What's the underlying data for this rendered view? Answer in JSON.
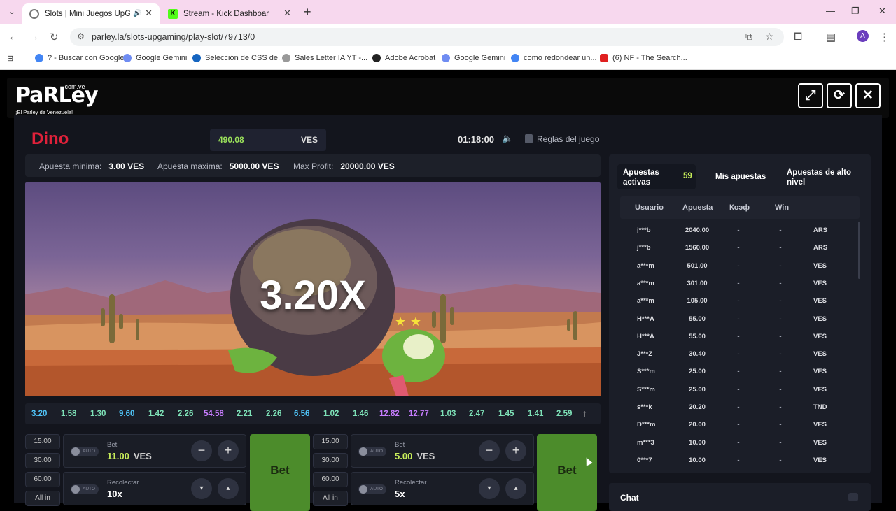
{
  "browser": {
    "tabs": [
      {
        "title": "Slots | Mini Juegos UpGam",
        "audio": "🔊",
        "close": "✕"
      },
      {
        "title": "Stream - Kick Dashboard",
        "close": "✕"
      }
    ],
    "new_tab": "+",
    "url": "parley.la/slots-upgaming/play-slot/79713/0",
    "avatar": "A",
    "bookmarks": [
      "? - Buscar con Google",
      "Google Gemini",
      "Selección de CSS de...",
      "Sales Letter IA YT -...",
      "Adobe Acrobat",
      "Google Gemini",
      "como redondear un...",
      "(6) NF - The Search..."
    ]
  },
  "site": {
    "logo": "PaRLey",
    "logo_sup": ".com.ve",
    "tagline": "¡El Parley de Venezuela!"
  },
  "game": {
    "title": "Dino",
    "balance": "490.08",
    "currency": "VES",
    "clock": "01:18:00",
    "rules": "Reglas del juego",
    "limits": {
      "min_label": "Apuesta minima:",
      "min_value": "3.00 VES",
      "max_label": "Apuesta maxima:",
      "max_value": "5000.00 VES",
      "profit_label": "Max Profit:",
      "profit_value": "20000.00 VES"
    },
    "multiplier": "3.20X",
    "history": [
      {
        "v": "3.20",
        "color": "#4fc3f7"
      },
      {
        "v": "1.58",
        "color": "#7ee2b8"
      },
      {
        "v": "1.30",
        "color": "#7ee2b8"
      },
      {
        "v": "9.60",
        "color": "#4fc3f7"
      },
      {
        "v": "1.42",
        "color": "#7ee2b8"
      },
      {
        "v": "2.26",
        "color": "#7ee2b8"
      },
      {
        "v": "54.58",
        "color": "#c77dff"
      },
      {
        "v": "2.21",
        "color": "#7ee2b8"
      },
      {
        "v": "2.26",
        "color": "#7ee2b8"
      },
      {
        "v": "6.56",
        "color": "#4fc3f7"
      },
      {
        "v": "1.02",
        "color": "#7ee2b8"
      },
      {
        "v": "1.46",
        "color": "#7ee2b8"
      },
      {
        "v": "12.82",
        "color": "#c77dff"
      },
      {
        "v": "12.77",
        "color": "#c77dff"
      },
      {
        "v": "1.03",
        "color": "#7ee2b8"
      },
      {
        "v": "2.47",
        "color": "#7ee2b8"
      },
      {
        "v": "1.45",
        "color": "#7ee2b8"
      },
      {
        "v": "1.41",
        "color": "#7ee2b8"
      },
      {
        "v": "2.59",
        "color": "#7ee2b8"
      }
    ],
    "panels": [
      {
        "quick": [
          "15.00",
          "30.00",
          "60.00",
          "All in"
        ],
        "auto": "AUTO",
        "bet_label": "Bet",
        "bet_value": "11.00",
        "bet_currency": "VES",
        "cashout_label": "Recolectar",
        "cashout_value": "10x",
        "bet_button": "Bet"
      },
      {
        "quick": [
          "15.00",
          "30.00",
          "60.00",
          "All in"
        ],
        "auto": "AUTO",
        "bet_label": "Bet",
        "bet_value": "5.00",
        "bet_currency": "VES",
        "cashout_label": "Recolectar",
        "cashout_value": "5x",
        "bet_button": "Bet"
      }
    ]
  },
  "bets": {
    "tab_active": "Apuestas activas",
    "count": "59",
    "tab_mine": "Mis apuestas",
    "tab_high": "Apuestas de alto nivel",
    "headers": [
      "Usuario",
      "Apuesta",
      "Коэф",
      "Win"
    ],
    "rows": [
      {
        "u": "j***b",
        "a": "2040.00",
        "k": "-",
        "w": "-",
        "c": "ARS"
      },
      {
        "u": "j***b",
        "a": "1560.00",
        "k": "-",
        "w": "-",
        "c": "ARS"
      },
      {
        "u": "a***m",
        "a": "501.00",
        "k": "-",
        "w": "-",
        "c": "VES"
      },
      {
        "u": "a***m",
        "a": "301.00",
        "k": "-",
        "w": "-",
        "c": "VES"
      },
      {
        "u": "a***m",
        "a": "105.00",
        "k": "-",
        "w": "-",
        "c": "VES"
      },
      {
        "u": "H***A",
        "a": "55.00",
        "k": "-",
        "w": "-",
        "c": "VES"
      },
      {
        "u": "H***A",
        "a": "55.00",
        "k": "-",
        "w": "-",
        "c": "VES"
      },
      {
        "u": "J***Z",
        "a": "30.40",
        "k": "-",
        "w": "-",
        "c": "VES"
      },
      {
        "u": "S***m",
        "a": "25.00",
        "k": "-",
        "w": "-",
        "c": "VES"
      },
      {
        "u": "S***m",
        "a": "25.00",
        "k": "-",
        "w": "-",
        "c": "VES"
      },
      {
        "u": "s***k",
        "a": "20.20",
        "k": "-",
        "w": "-",
        "c": "TND"
      },
      {
        "u": "D***m",
        "a": "20.00",
        "k": "-",
        "w": "-",
        "c": "VES"
      },
      {
        "u": "m***3",
        "a": "10.00",
        "k": "-",
        "w": "-",
        "c": "VES"
      },
      {
        "u": "0***7",
        "a": "10.00",
        "k": "-",
        "w": "-",
        "c": "VES"
      }
    ],
    "chat_label": "Chat"
  },
  "colors": {
    "accent_green": "#c8ee5a",
    "bet_button": "#4c8c2b",
    "title_red": "#e0213a"
  }
}
